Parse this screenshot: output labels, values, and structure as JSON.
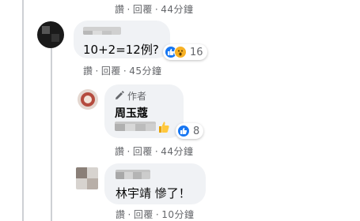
{
  "comments": [
    {
      "meta": {
        "action1": "讚",
        "action2": "回覆",
        "time": "44分鐘"
      }
    },
    {
      "text": "10+2=12例?",
      "reaction_count": "16",
      "meta": {
        "action1": "讚",
        "action2": "回覆",
        "time": "45分鐘"
      }
    },
    {
      "badge": "作者",
      "author": "周玉蔻",
      "reaction_count": "8",
      "meta": {
        "action1": "讚",
        "action2": "回覆",
        "time": "44分鐘"
      }
    },
    {
      "text": "林宇靖 慘了！",
      "meta": {
        "action1": "讚",
        "action2": "回覆",
        "time": "10分鐘"
      }
    }
  ],
  "colors": {
    "bubble": "#f0f2f5",
    "meta": "#65676b",
    "like": "#1877f2",
    "wow": "#f7b125",
    "thread": "#ced0d4"
  },
  "icons": [
    "like-reaction-icon",
    "wow-reaction-icon",
    "pencil-icon",
    "thumbs-up-emoji-icon"
  ]
}
